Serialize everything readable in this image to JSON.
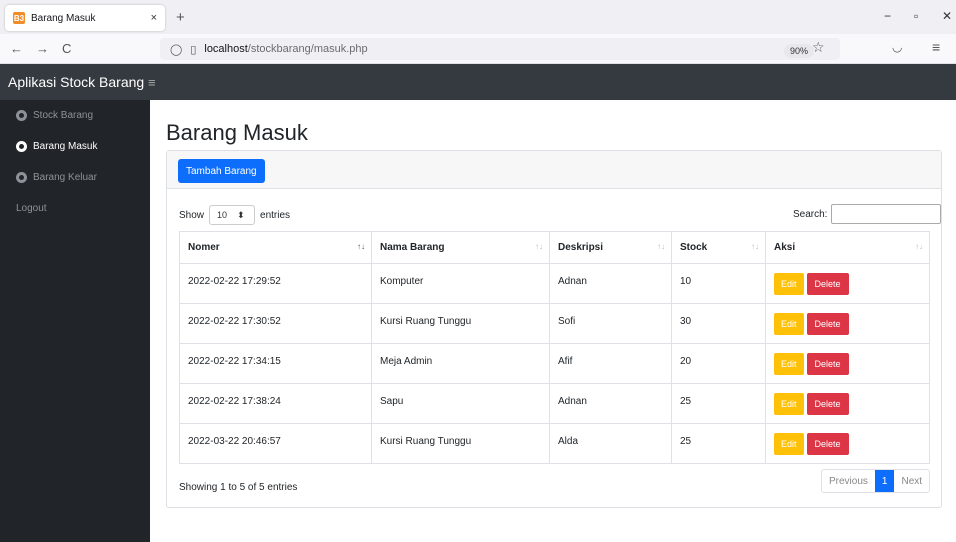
{
  "browser": {
    "tab_title": "Barang Masuk",
    "tab_favicon": "B3",
    "tab_close": "×",
    "new_tab": "+",
    "url_host": "localhost",
    "url_path": "/stockbarang/masuk.php",
    "zoom": "90%",
    "back": "←",
    "forward": "→",
    "reload": "C",
    "minimize": "−",
    "maximize": "▫",
    "close": "✕",
    "shield": "◯",
    "page_icon": "▯",
    "star": "☆",
    "pocket": "◡",
    "menu": "≡"
  },
  "app": {
    "brand": "Aplikasi Stock Barang",
    "hamburger": "≡"
  },
  "sidebar": {
    "items": [
      {
        "label": "Stock Barang",
        "active": false
      },
      {
        "label": "Barang Masuk",
        "active": true
      },
      {
        "label": "Barang Keluar",
        "active": false
      },
      {
        "label": "Logout",
        "active": false
      }
    ]
  },
  "main": {
    "title": "Barang Masuk",
    "add_button": "Tambah Barang",
    "show_label": "Show",
    "entries_value": "10",
    "entries_label": "entries",
    "search_label": "Search:",
    "columns": [
      "Nomer",
      "Nama Barang",
      "Deskripsi",
      "Stock",
      "Aksi"
    ],
    "rows": [
      {
        "nomer": "2022-02-22 17:29:52",
        "nama": "Komputer",
        "deskripsi": "Adnan",
        "stock": "10"
      },
      {
        "nomer": "2022-02-22 17:30:52",
        "nama": "Kursi Ruang Tunggu",
        "deskripsi": "Sofi",
        "stock": "30"
      },
      {
        "nomer": "2022-02-22 17:34:15",
        "nama": "Meja Admin",
        "deskripsi": "Afif",
        "stock": "20"
      },
      {
        "nomer": "2022-02-22 17:38:24",
        "nama": "Sapu",
        "deskripsi": "Adnan",
        "stock": "25"
      },
      {
        "nomer": "2022-03-22 20:46:57",
        "nama": "Kursi Ruang Tunggu",
        "deskripsi": "Alda",
        "stock": "25"
      }
    ],
    "edit_label": "Edit",
    "delete_label": "Delete",
    "info": "Showing 1 to 5 of 5 entries",
    "prev": "Previous",
    "page": "1",
    "next": "Next"
  },
  "colors": {
    "primary": "#0d6efd",
    "warning": "#ffc107",
    "danger": "#dc3545",
    "navbar": "#343a40",
    "sidebar": "#212529"
  }
}
